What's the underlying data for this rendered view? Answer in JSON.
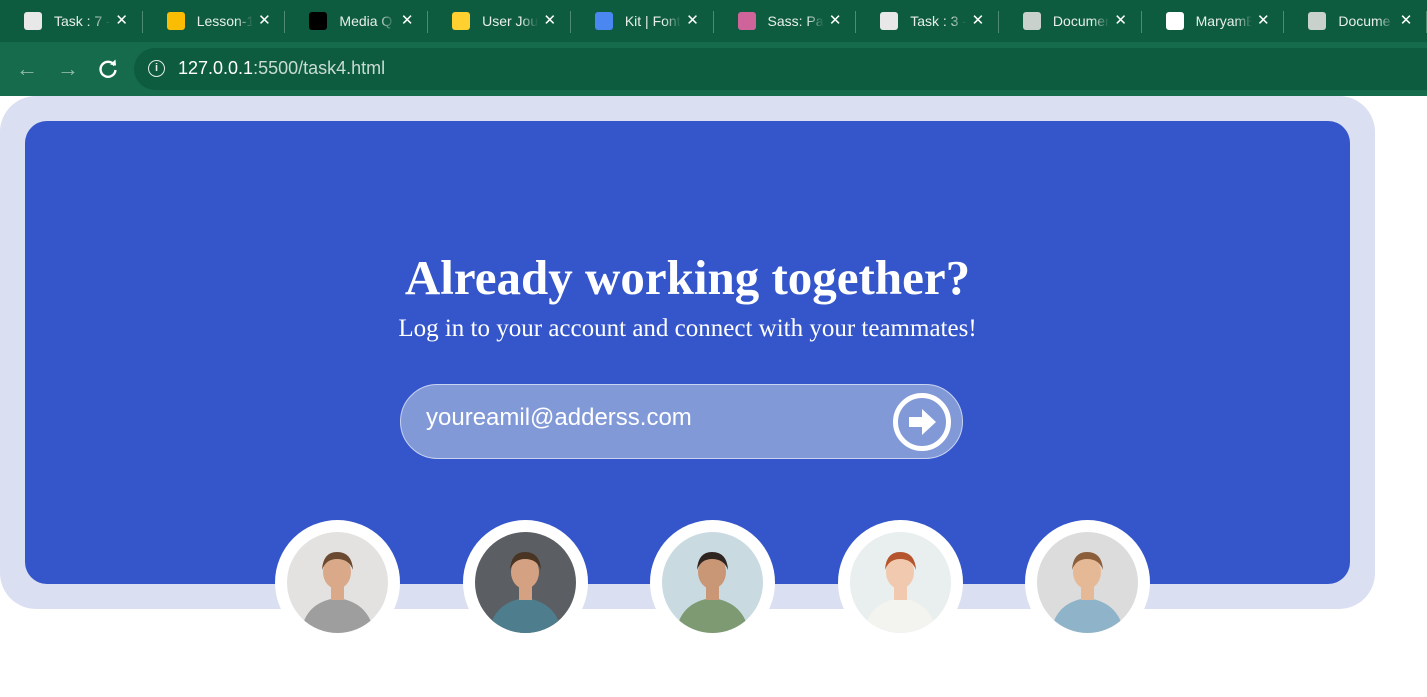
{
  "browser": {
    "tabs": [
      {
        "title": "Task : 7 -",
        "icon": "classroom-icon",
        "color": "#e8e8e8"
      },
      {
        "title": "Lesson-1",
        "icon": "google-drive-icon",
        "color": "#fbbc04"
      },
      {
        "title": "Media Q",
        "icon": "angular-icon",
        "color": "#000000"
      },
      {
        "title": "User Jou",
        "icon": "miro-icon",
        "color": "#ffd02f"
      },
      {
        "title": "Kit | Font",
        "icon": "flag-icon",
        "color": "#4b87f0"
      },
      {
        "title": "Sass: Par",
        "icon": "sass-icon",
        "color": "#cf649a"
      },
      {
        "title": "Task : 3 -",
        "icon": "classroom-icon",
        "color": "#e8e8e8"
      },
      {
        "title": "Documen",
        "icon": "globe-icon",
        "color": "#c9d1cc"
      },
      {
        "title": "MaryamE",
        "icon": "github-icon",
        "color": "#ffffff"
      },
      {
        "title": "Docume",
        "icon": "globe-icon",
        "color": "#c9d1cc"
      }
    ],
    "url_host": "127.0.0.1",
    "url_path": ":5500/task4.html"
  },
  "hero": {
    "heading": "Already working together?",
    "subheading": "Log in to your account and connect with your teammates!",
    "email_placeholder": "youreamil@adderss.com",
    "submit_icon": "arrow-circle-right-icon"
  },
  "team": [
    {
      "name": "team-member-1",
      "bg": "#e4e2e0",
      "shirt": "#9e9e9e",
      "hair": "#6b4a32",
      "skin": "#d9a98a"
    },
    {
      "name": "team-member-2",
      "bg": "#5b5f63",
      "shirt": "#4e7d8e",
      "hair": "#4a3424",
      "skin": "#d4a282"
    },
    {
      "name": "team-member-3",
      "bg": "#c9dbe1",
      "shirt": "#7d9a72",
      "hair": "#2f2520",
      "skin": "#c99676"
    },
    {
      "name": "team-member-4",
      "bg": "#e9eeee",
      "shirt": "#f3f3f0",
      "hair": "#b5552e",
      "skin": "#f0c9ae"
    },
    {
      "name": "team-member-5",
      "bg": "#dcdcdc",
      "shirt": "#8fb4c9",
      "hair": "#8b5e3c",
      "skin": "#e6b996"
    }
  ],
  "colors": {
    "card": "#3456ca",
    "outer": "#dadff2",
    "chrome_dark": "#0e5c3f",
    "chrome": "#166b4c"
  }
}
